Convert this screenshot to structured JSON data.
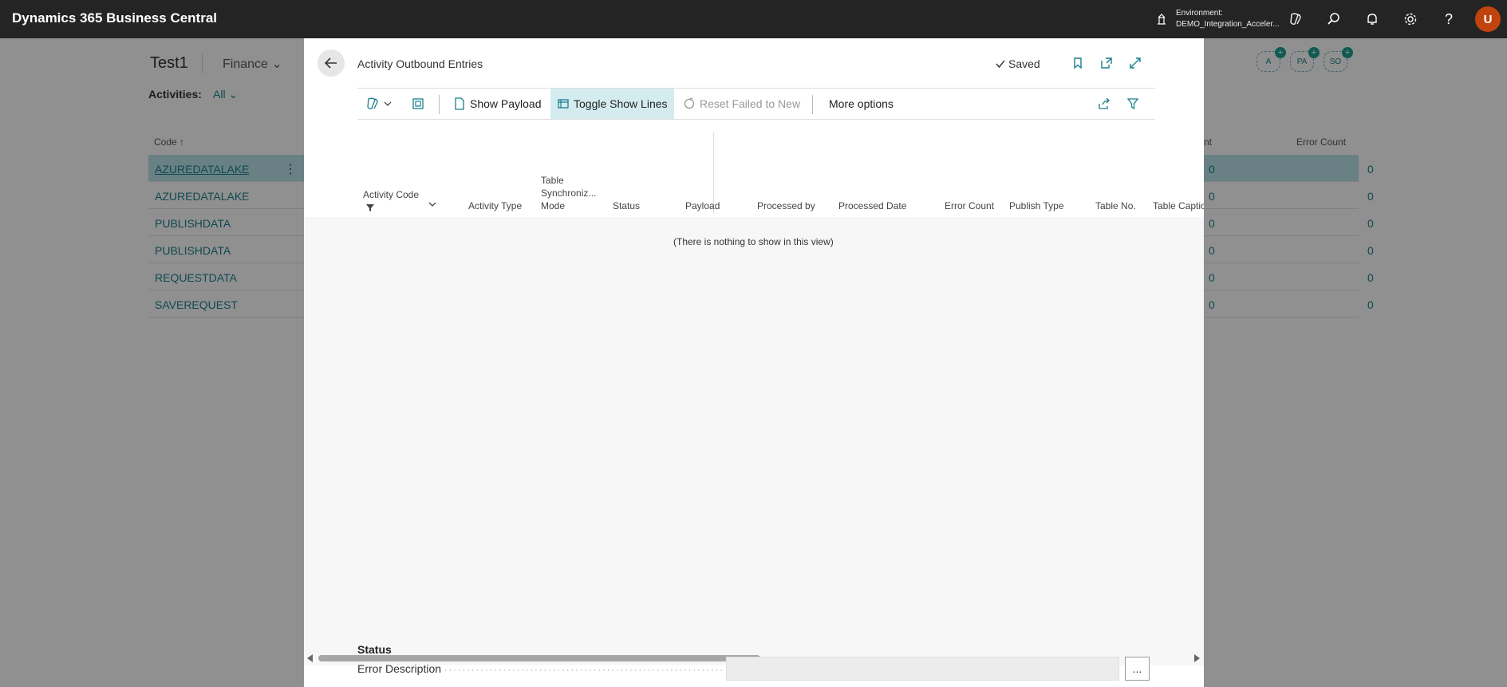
{
  "topbar": {
    "brand": "Dynamics 365 Business Central",
    "environment_label": "Environment:",
    "environment_value": "DEMO_Integration_Acceler...",
    "avatar_initial": "U"
  },
  "background_page": {
    "title": "Test1",
    "nav_item": "Finance",
    "activities_label": "Activities:",
    "activities_value": "All",
    "column_code": "Code ↑",
    "column_count_partial": "nt",
    "column_error_count": "Error Count",
    "personas": [
      "A",
      "PA",
      "SO"
    ],
    "rows": [
      {
        "code": "AZUREDATALAKE",
        "count": "0",
        "error_count": "0",
        "selected": true
      },
      {
        "code": "AZUREDATALAKE",
        "count": "0",
        "error_count": "0",
        "selected": false
      },
      {
        "code": "PUBLISHDATA",
        "count": "0",
        "error_count": "0",
        "selected": false
      },
      {
        "code": "PUBLISHDATA",
        "count": "0",
        "error_count": "0",
        "selected": false
      },
      {
        "code": "REQUESTDATA",
        "count": "0",
        "error_count": "0",
        "selected": false
      },
      {
        "code": "SAVEREQUEST",
        "count": "0",
        "error_count": "0",
        "selected": false
      }
    ]
  },
  "dialog": {
    "title": "Activity Outbound Entries",
    "saved": "Saved",
    "actions": {
      "show_payload": "Show Payload",
      "toggle_show_lines": "Toggle Show Lines",
      "reset_failed": "Reset Failed to New",
      "more_options": "More options"
    },
    "columns": {
      "activity_code": "Activity Code",
      "activity_type": "Activity Type",
      "table_sync_1": "Table",
      "table_sync_2": "Synchroniz...",
      "table_sync_3": "Mode",
      "status": "Status",
      "payload": "Payload",
      "processed_by": "Processed by",
      "processed_date": "Processed Date",
      "error_count": "Error Count",
      "publish_type": "Publish Type",
      "table_no": "Table No.",
      "table_caption": "Table Captio"
    },
    "empty_message": "(There is nothing to show in this view)",
    "factbox": {
      "title": "Status",
      "error_description_label": "Error Description",
      "error_description_value": "",
      "assist_button": "..."
    }
  },
  "colors": {
    "accent": "#1a7e8c",
    "topbar": "#242424",
    "avatar": "#c1440e",
    "selected_row": "#b5dfe3"
  }
}
